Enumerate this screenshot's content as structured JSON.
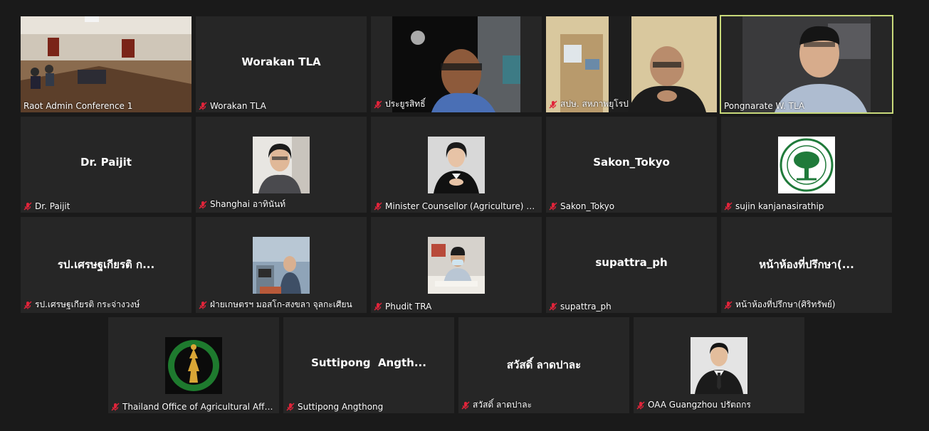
{
  "participants": [
    {
      "name": "Raot Admin Conference 1",
      "kind": "video-room",
      "muted": false
    },
    {
      "name": "Worakan TLA",
      "display": "Worakan TLA",
      "kind": "name",
      "muted": true
    },
    {
      "name": "ประยูรสิทธิ์",
      "kind": "video-man-glasses",
      "muted": true
    },
    {
      "name": "สปษ. สหภาพยุโรป",
      "kind": "video-man-hands",
      "muted": true
    },
    {
      "name": "Pongnarate W. TLA",
      "kind": "video-speaker",
      "muted": false,
      "active": true
    },
    {
      "name": "Dr. Paijit",
      "display": "Dr. Paijit",
      "kind": "name",
      "muted": true
    },
    {
      "name": "Shanghai อาทินันท์",
      "kind": "avatar-woman-glasses",
      "muted": true
    },
    {
      "name": "Minister Counsellor (Agriculture) Th...",
      "kind": "avatar-woman-suit",
      "muted": true
    },
    {
      "name": "Sakon_Tokyo",
      "display": "Sakon_Tokyo",
      "kind": "name",
      "muted": true
    },
    {
      "name": "sujin kanjanasirathip",
      "kind": "avatar-tree-logo",
      "muted": true
    },
    {
      "name": "รป.เศรษฐเกียรติ กระจ่างวงษ์",
      "display": "รป.เศรษฐเกียรติ ก...",
      "kind": "name",
      "muted": true
    },
    {
      "name": "ฝ่ายเกษตรฯ มอสโก-สงขลา จุลกะเศียน",
      "kind": "avatar-office-man",
      "muted": true
    },
    {
      "name": "Phudit TRA",
      "kind": "avatar-man-mask",
      "muted": true
    },
    {
      "name": "supattra_ph",
      "display": "supattra_ph",
      "kind": "name",
      "muted": true
    },
    {
      "name": "หน้าห้องที่ปรึกษา(ศิริทรัพย์)",
      "display": "หน้าห้องที่ปรึกษา(...",
      "kind": "name",
      "muted": true
    },
    {
      "name": "Thailand Office of Agricultural Affai...",
      "kind": "avatar-green-seal",
      "muted": true
    },
    {
      "name": "Suttipong Angthong",
      "display": "Suttipong  Angth...",
      "kind": "name",
      "muted": true
    },
    {
      "name": "สวัสดิ์ ลาดปาละ",
      "display": "สวัสดิ์ ลาดปาละ",
      "kind": "name",
      "muted": true
    },
    {
      "name": "OAA Guangzhou ปรัตถกร",
      "kind": "avatar-man-suit",
      "muted": true
    }
  ],
  "colors": {
    "background": "#1a1a1a",
    "tile": "#262626",
    "active_border": "#c8d97a",
    "muted_icon": "#e0243a"
  }
}
